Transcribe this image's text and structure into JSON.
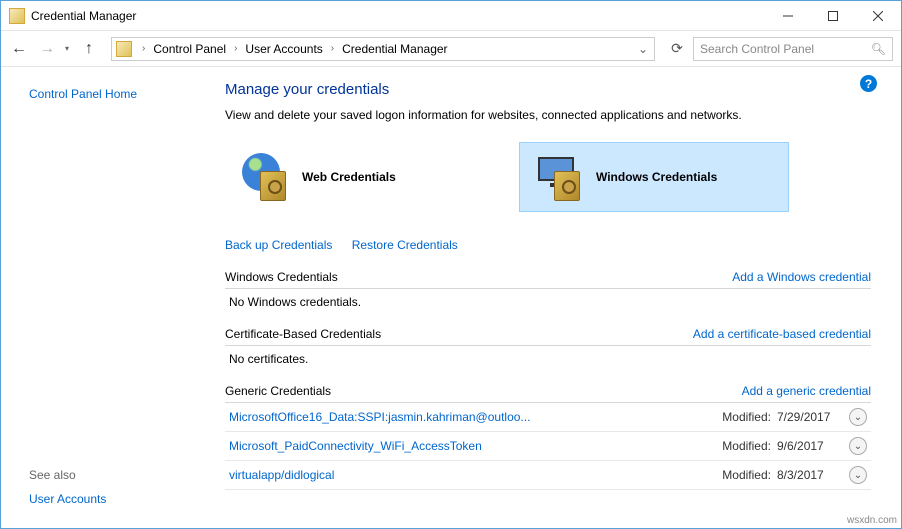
{
  "titlebar": {
    "title": "Credential Manager"
  },
  "breadcrumb": {
    "seg1": "Control Panel",
    "seg2": "User Accounts",
    "seg3": "Credential Manager"
  },
  "search": {
    "placeholder": "Search Control Panel"
  },
  "sidebar": {
    "home": "Control Panel Home",
    "see_also": "See also",
    "user_accounts": "User Accounts"
  },
  "main": {
    "heading": "Manage your credentials",
    "subtext": "View and delete your saved logon information for websites, connected applications and networks.",
    "tiles": {
      "web": "Web Credentials",
      "windows": "Windows Credentials"
    },
    "links": {
      "backup": "Back up Credentials",
      "restore": "Restore Credentials"
    },
    "sections": {
      "windows": {
        "title": "Windows Credentials",
        "add": "Add a Windows credential",
        "empty": "No Windows credentials."
      },
      "cert": {
        "title": "Certificate-Based Credentials",
        "add": "Add a certificate-based credential",
        "empty": "No certificates."
      },
      "generic": {
        "title": "Generic Credentials",
        "add": "Add a generic credential",
        "modified_label": "Modified:",
        "items": [
          {
            "name": "MicrosoftOffice16_Data:SSPI:jasmin.kahriman@outloo...",
            "date": "7/29/2017"
          },
          {
            "name": "Microsoft_PaidConnectivity_WiFi_AccessToken",
            "date": "9/6/2017"
          },
          {
            "name": "virtualapp/didlogical",
            "date": "8/3/2017"
          }
        ]
      }
    }
  },
  "footer": {
    "src": "wsxdn.com"
  }
}
